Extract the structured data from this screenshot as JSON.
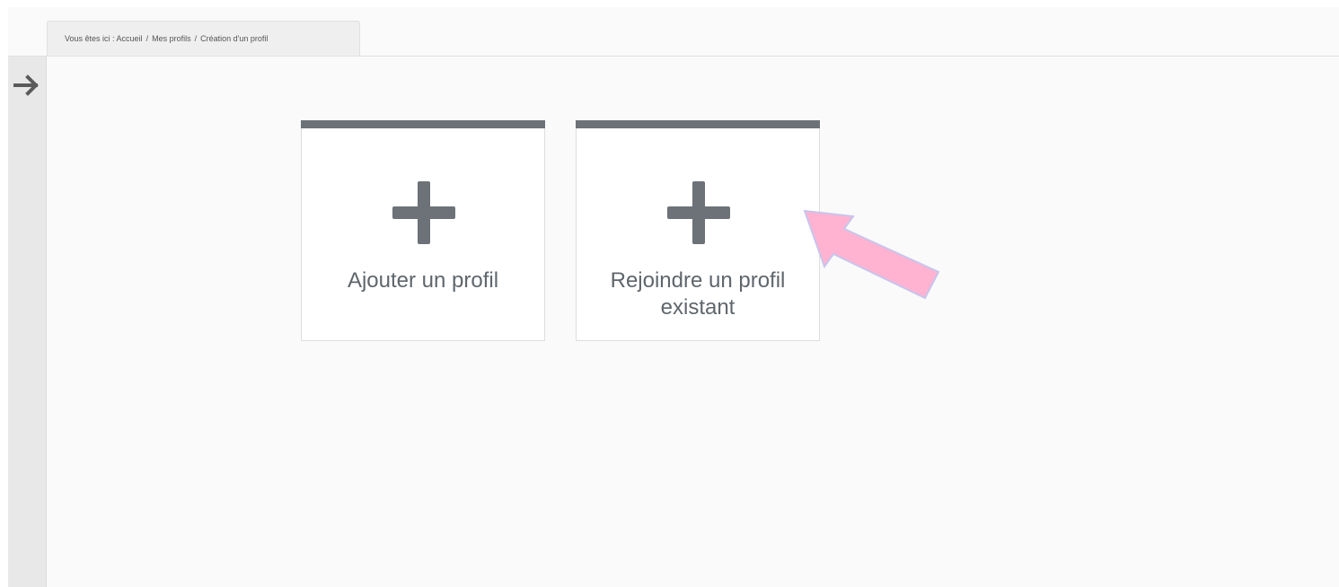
{
  "breadcrumb": {
    "prefix": "Vous êtes ici :",
    "items": [
      "Accueil",
      "Mes profils",
      "Création d'un profil"
    ],
    "separator": "/"
  },
  "sidebar": {
    "toggle_icon": "arrow-right-icon"
  },
  "cards": [
    {
      "icon": "plus-icon",
      "label": "Ajouter un profil"
    },
    {
      "icon": "plus-icon",
      "label": "Rejoindre un profil existant"
    }
  ],
  "colors": {
    "accent": "#6c7277",
    "label": "#5f666c",
    "highlight_arrow": "#ffb3d1"
  }
}
